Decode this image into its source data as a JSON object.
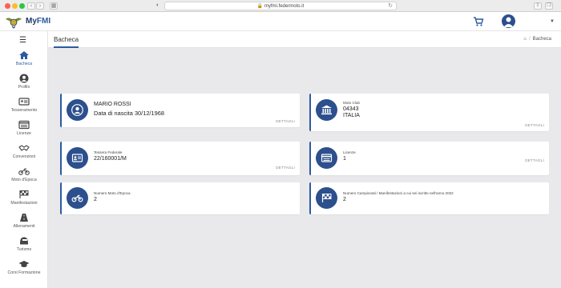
{
  "browser": {
    "url": "myfmi.federmoto.it"
  },
  "app": {
    "brand_prefix": "My",
    "brand_accent": "FMI",
    "accent_color": "#2c5aa0"
  },
  "sidebar": {
    "items": [
      {
        "label": "Bacheca",
        "icon": "home-icon"
      },
      {
        "label": "Profilo",
        "icon": "user-icon"
      },
      {
        "label": "Tesseramento",
        "icon": "id-card-icon"
      },
      {
        "label": "Licenze",
        "icon": "license-icon"
      },
      {
        "label": "Convenzioni",
        "icon": "handshake-icon"
      },
      {
        "label": "Moto d'Epoca",
        "icon": "motorcycle-icon"
      },
      {
        "label": "Manifestazioni",
        "icon": "flag-icon"
      },
      {
        "label": "Allenamenti",
        "icon": "road-icon"
      },
      {
        "label": "Turismo",
        "icon": "helmet-icon"
      },
      {
        "label": "Corsi Formazione",
        "icon": "graduation-cap-icon"
      }
    ]
  },
  "page": {
    "title": "Bacheca",
    "breadcrumb": "Bacheca"
  },
  "cards": {
    "user": {
      "name": "MARIO ROSSI",
      "birth": "Data di nascita 30/12/1968",
      "details": "DETTAGLI"
    },
    "motoclub": {
      "label": "Moto Club",
      "code": "04343",
      "country": "ITALIA",
      "details": "DETTAGLI"
    },
    "tessera": {
      "label": "Tessera Federale",
      "value": "22/160001/M",
      "details": "DETTAGLI"
    },
    "licenze": {
      "label": "Licenze",
      "value": "1",
      "details": "DETTAGLI"
    },
    "motoepoca": {
      "label": "Numero Moto d'Epoca",
      "value": "2"
    },
    "campionati": {
      "label": "Numero Campionati / Manifestazioni a cui sei iscritto nell'anno 2022",
      "value": "2"
    }
  }
}
